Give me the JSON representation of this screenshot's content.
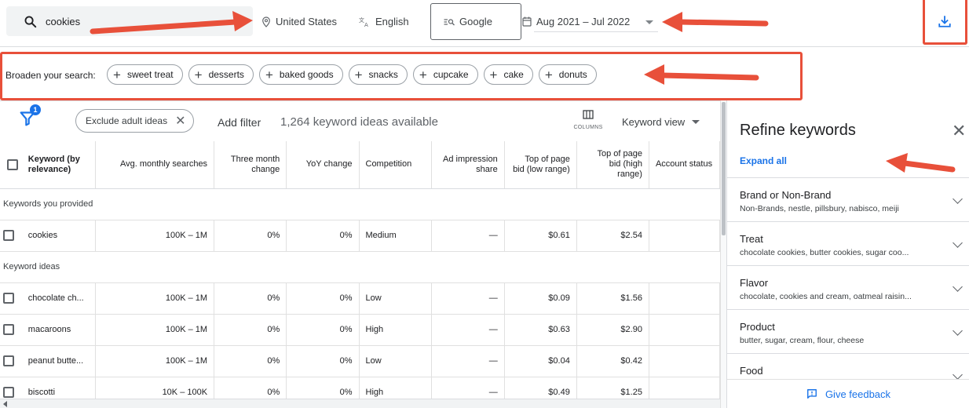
{
  "search": {
    "query": "cookies"
  },
  "filters": {
    "location": "United States",
    "language": "English",
    "network": "Google",
    "date_range": "Aug 2021 – Jul 2022"
  },
  "broaden": {
    "label": "Broaden your search:",
    "chips": [
      "sweet treat",
      "desserts",
      "baked goods",
      "snacks",
      "cupcake",
      "cake",
      "donuts"
    ]
  },
  "toolbar": {
    "filter_badge": "1",
    "exclude_adult": "Exclude adult ideas",
    "add_filter": "Add filter",
    "keyword_count": "1,264 keyword ideas available",
    "columns_label": "COLUMNS",
    "keyword_view": "Keyword view"
  },
  "table": {
    "headers": [
      "Keyword (by relevance)",
      "Avg. monthly searches",
      "Three month change",
      "YoY change",
      "Competition",
      "Ad impression share",
      "Top of page bid (low range)",
      "Top of page bid (high range)",
      "Account status"
    ],
    "group_provided": "Keywords you provided",
    "group_ideas": "Keyword ideas",
    "provided": [
      [
        "cookies",
        "100K – 1M",
        "0%",
        "0%",
        "Medium",
        "—",
        "$0.61",
        "$2.54",
        ""
      ]
    ],
    "ideas": [
      [
        "chocolate ch...",
        "100K – 1M",
        "0%",
        "0%",
        "Low",
        "—",
        "$0.09",
        "$1.56",
        ""
      ],
      [
        "macaroons",
        "100K – 1M",
        "0%",
        "0%",
        "High",
        "—",
        "$0.63",
        "$2.90",
        ""
      ],
      [
        "peanut butte...",
        "100K – 1M",
        "0%",
        "0%",
        "Low",
        "—",
        "$0.04",
        "$0.42",
        ""
      ],
      [
        "biscotti",
        "10K – 100K",
        "0%",
        "0%",
        "High",
        "—",
        "$0.49",
        "$1.25",
        ""
      ]
    ]
  },
  "refine": {
    "title": "Refine keywords",
    "expand_all": "Expand all",
    "items": [
      {
        "title": "Brand or Non-Brand",
        "sub": "Non-Brands, nestle, pillsbury, nabisco, meiji"
      },
      {
        "title": "Treat",
        "sub": "chocolate cookies, butter cookies, sugar coo..."
      },
      {
        "title": "Flavor",
        "sub": "chocolate, cookies and cream, oatmeal raisin..."
      },
      {
        "title": "Product",
        "sub": "butter, sugar, cream, flour, cheese"
      },
      {
        "title": "Food",
        "sub": ""
      }
    ],
    "feedback": "Give feedback"
  },
  "colors": {
    "accent": "#1a73e8",
    "annotation": "#e8503a"
  }
}
